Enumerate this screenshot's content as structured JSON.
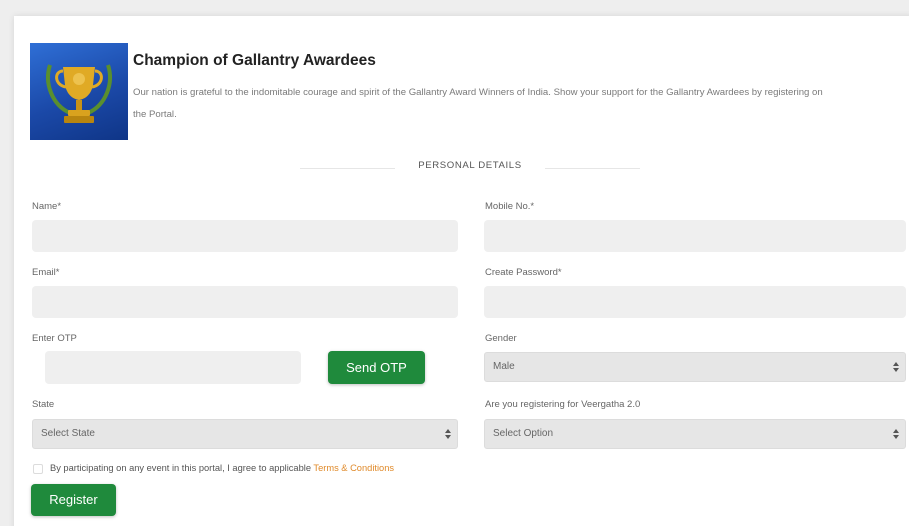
{
  "header": {
    "title": "Champion of Gallantry Awardees",
    "description": "Our nation is grateful to the indomitable courage and spirit of the Gallantry Award Winners of India. Show your support for the Gallantry Awardees by registering on the Portal."
  },
  "logo": {
    "icon": "trophy-icon",
    "colors": {
      "background": "#1b49a8",
      "trophy": "#d9a21e"
    }
  },
  "section": {
    "title": "PERSONAL DETAILS"
  },
  "form": {
    "name_label": "Name*",
    "mobile_label": "Mobile No.*",
    "email_label": "Email*",
    "password_label": "Create Password*",
    "otp_label": "Enter OTP",
    "send_otp_label": "Send OTP",
    "gender_label": "Gender",
    "gender_value": "Male",
    "state_label": "State",
    "state_value": "Select State",
    "veergatha_label": "Are you registering for Veergatha 2.0",
    "veergatha_value": "Select Option",
    "terms_text": "By participating on any event in this portal, I agree to applicable",
    "terms_link": "Terms & Conditions",
    "register_label": "Register"
  },
  "colors": {
    "accent_green": "#1f8a3c",
    "link_orange": "#e08a2a"
  }
}
